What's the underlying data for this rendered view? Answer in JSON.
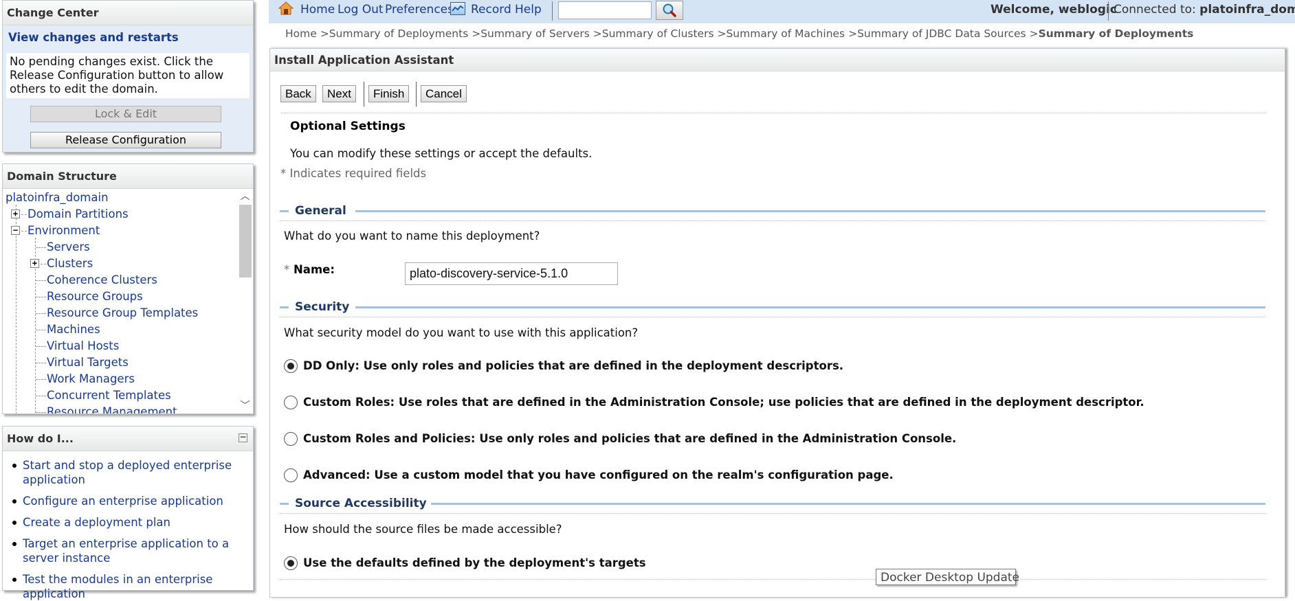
{
  "change_center": {
    "title": "Change Center",
    "view_link": "View changes and restarts",
    "message": "No pending changes exist. Click the Release Configuration button to allow others to edit the domain.",
    "lock_edit_label": "Lock & Edit",
    "release_config_label": "Release Configuration"
  },
  "domain_structure": {
    "title": "Domain Structure",
    "root": "platoinfra_domain",
    "items": [
      {
        "label": "Domain Partitions",
        "toggle": "+"
      },
      {
        "label": "Environment",
        "toggle": "-"
      },
      {
        "label": "Servers"
      },
      {
        "label": "Clusters",
        "toggle": "+"
      },
      {
        "label": "Coherence Clusters"
      },
      {
        "label": "Resource Groups"
      },
      {
        "label": "Resource Group Templates"
      },
      {
        "label": "Machines"
      },
      {
        "label": "Virtual Hosts"
      },
      {
        "label": "Virtual Targets"
      },
      {
        "label": "Work Managers"
      },
      {
        "label": "Concurrent Templates"
      },
      {
        "label": "Resource Management"
      }
    ]
  },
  "how_do_i": {
    "title": "How do I...",
    "items": [
      "Start and stop a deployed enterprise application",
      "Configure an enterprise application",
      "Create a deployment plan",
      "Target an enterprise application to a server instance",
      "Test the modules in an enterprise application"
    ]
  },
  "topbar": {
    "home": "Home",
    "logout": "Log Out",
    "preferences": "Preferences",
    "record": "Record",
    "help": "Help",
    "search_value": "",
    "welcome_prefix": "Welcome, ",
    "user": "weblogic",
    "connected_prefix": "Connected to: ",
    "domain": "platoinfra_domain"
  },
  "breadcrumb": {
    "items": [
      "Home",
      "Summary of Deployments",
      "Summary of Servers",
      "Summary of Clusters",
      "Summary of Machines",
      "Summary of JDBC Data Sources"
    ],
    "current": "Summary of Deployments",
    "separator": " >"
  },
  "main": {
    "title": "Install Application Assistant",
    "buttons": {
      "back": "Back",
      "next": "Next",
      "finish": "Finish",
      "cancel": "Cancel"
    },
    "heading": "Optional Settings",
    "intro": "You can modify these settings or accept the defaults.",
    "required_note": "* Indicates required fields",
    "general": {
      "title": "General",
      "question": "What do you want to name this deployment?",
      "name_label": "Name:",
      "name_required_mark": "*",
      "name_value": "plato-discovery-service-5.1.0"
    },
    "security": {
      "title": "Security",
      "question": "What security model do you want to use with this application?",
      "options": [
        {
          "label": "DD Only: Use only roles and policies that are defined in the deployment descriptors.",
          "checked": true
        },
        {
          "label": "Custom Roles: Use roles that are defined in the Administration Console; use policies that are defined in the deployment descriptor.",
          "checked": false
        },
        {
          "label": "Custom Roles and Policies: Use only roles and policies that are defined in the Administration Console.",
          "checked": false
        },
        {
          "label": "Advanced: Use a custom model that you have configured on the realm's configuration page.",
          "checked": false
        }
      ]
    },
    "source": {
      "title": "Source Accessibility",
      "question": "How should the source files be made accessible?",
      "options": [
        {
          "label": "Use the defaults defined by the deployment's targets",
          "checked": true
        }
      ]
    }
  },
  "tooltip": {
    "text": "Docker Desktop Update"
  },
  "colors": {
    "link": "#1a3a8c",
    "topbar_bg": "#d5e4f5",
    "section_line": "#a6c0de",
    "section_title": "#1e3a63"
  }
}
